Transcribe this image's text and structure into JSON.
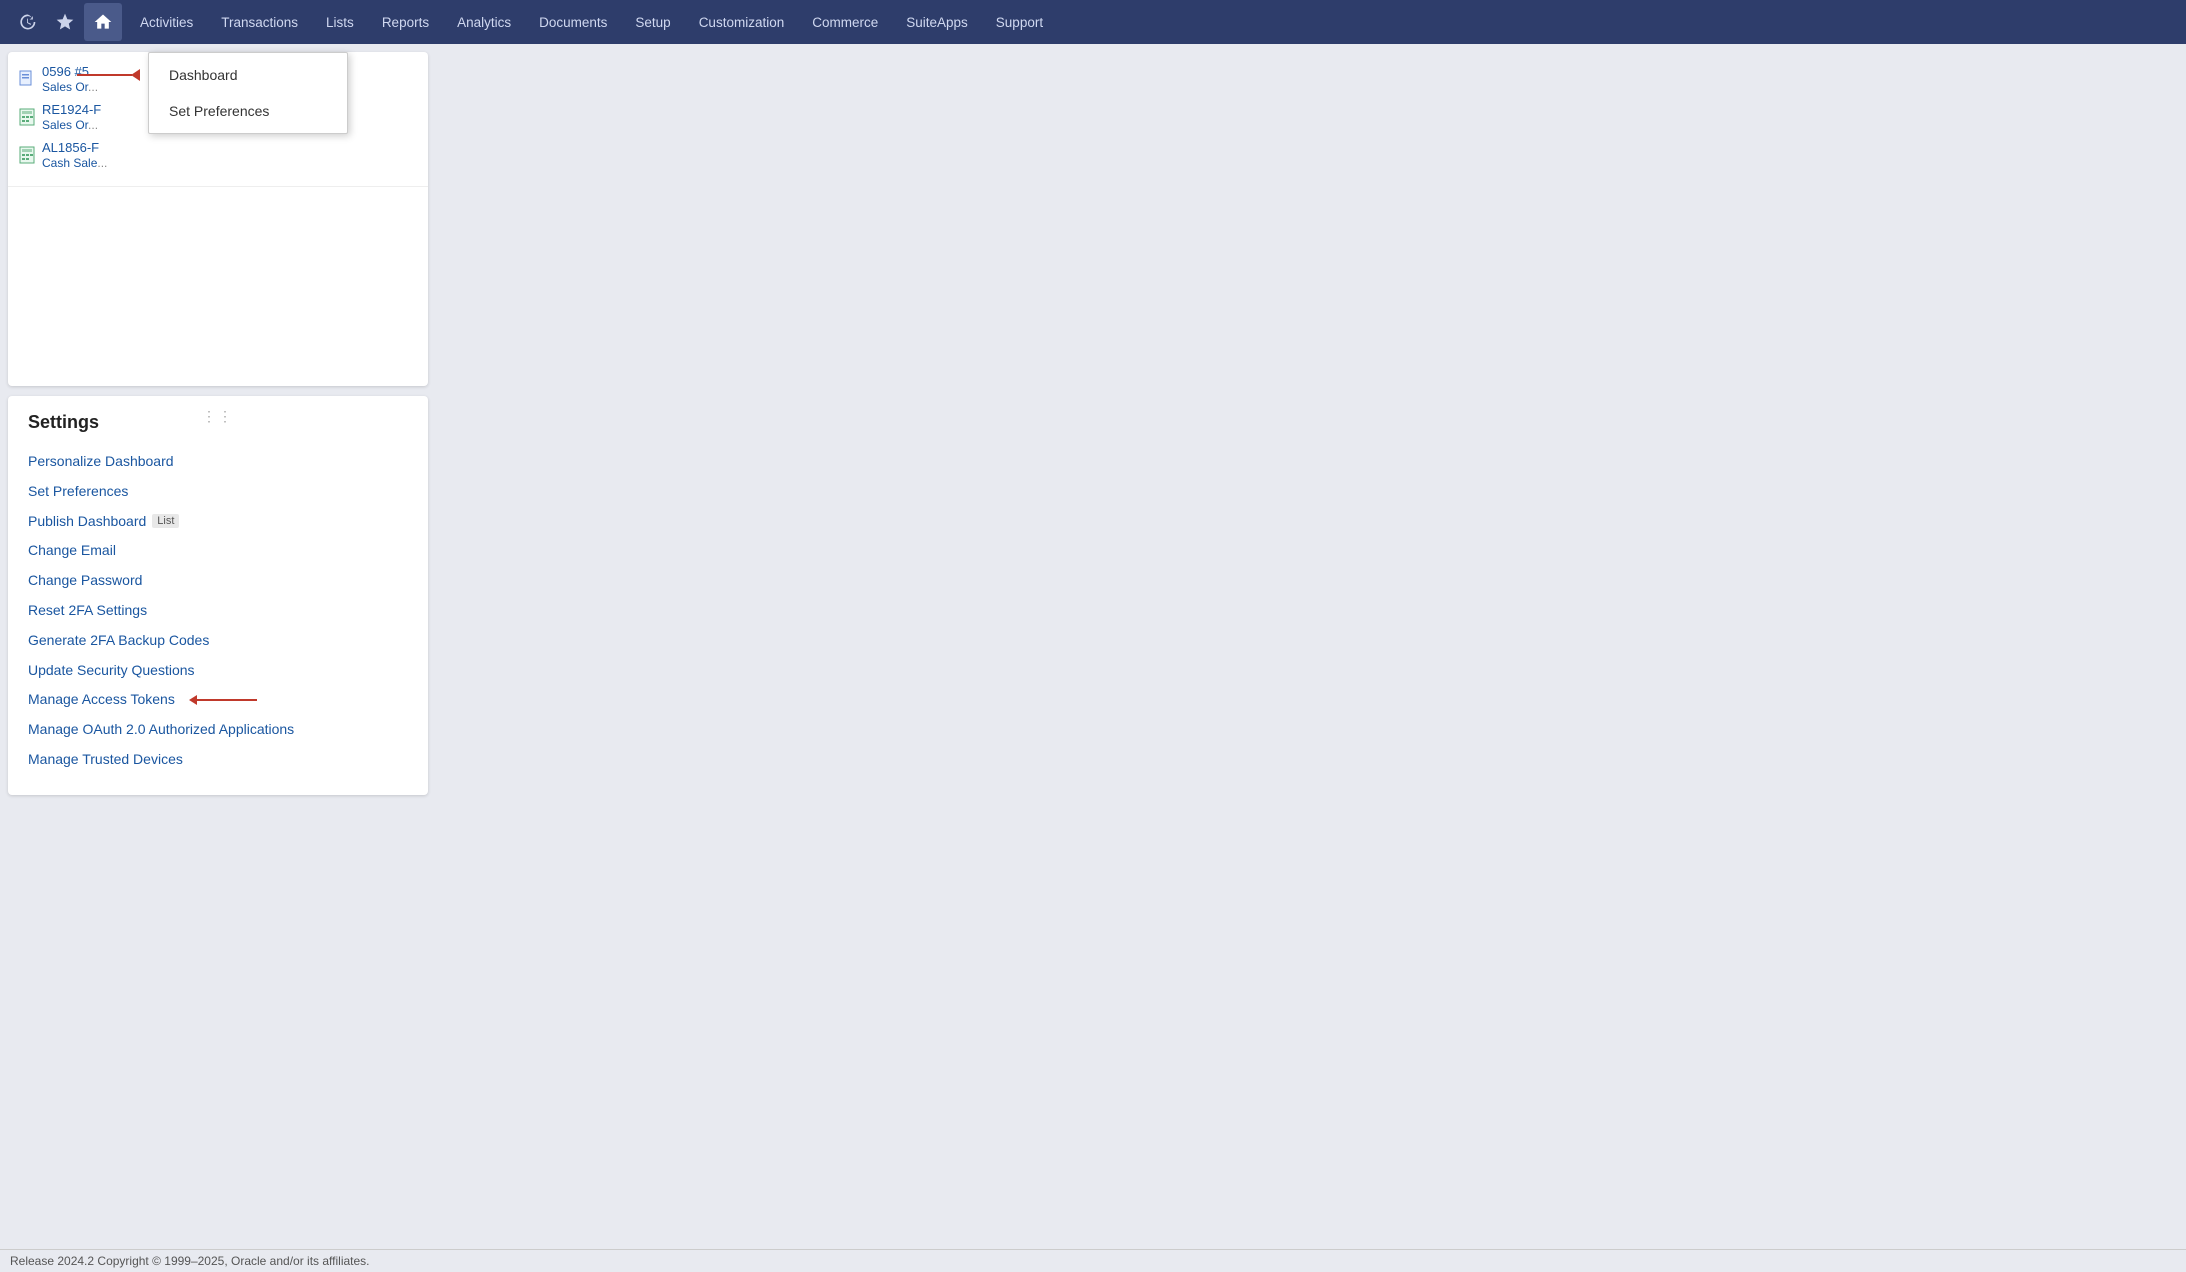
{
  "navbar": {
    "items": [
      {
        "label": "Activities",
        "id": "activities"
      },
      {
        "label": "Transactions",
        "id": "transactions"
      },
      {
        "label": "Lists",
        "id": "lists"
      },
      {
        "label": "Reports",
        "id": "reports"
      },
      {
        "label": "Analytics",
        "id": "analytics"
      },
      {
        "label": "Documents",
        "id": "documents"
      },
      {
        "label": "Setup",
        "id": "setup"
      },
      {
        "label": "Customization",
        "id": "customization"
      },
      {
        "label": "Commerce",
        "id": "commerce"
      },
      {
        "label": "SuiteApps",
        "id": "suiteapps"
      },
      {
        "label": "Support",
        "id": "support"
      }
    ]
  },
  "dropdown": {
    "items": [
      {
        "label": "Dashboard",
        "id": "dashboard"
      },
      {
        "label": "Set Preferences",
        "id": "set-preferences"
      }
    ]
  },
  "recent_items": [
    {
      "id": "item1",
      "code": "0596 #5",
      "name": "Sales Or...",
      "icon": "doc"
    },
    {
      "id": "item2",
      "code": "RE1924-F",
      "name": "Sales Or...",
      "icon": "calc"
    },
    {
      "id": "item3",
      "code": "AL1856-F",
      "name": "Cash Sale...",
      "icon": "calc"
    }
  ],
  "settings": {
    "title": "Settings",
    "links": [
      {
        "label": "Personalize Dashboard",
        "id": "personalize-dashboard",
        "badge": null
      },
      {
        "label": "Set Preferences",
        "id": "set-preferences",
        "badge": null
      },
      {
        "label": "Publish Dashboard",
        "id": "publish-dashboard",
        "badge": "List"
      },
      {
        "label": "Change Email",
        "id": "change-email",
        "badge": null
      },
      {
        "label": "Change Password",
        "id": "change-password",
        "badge": null
      },
      {
        "label": "Reset 2FA Settings",
        "id": "reset-2fa",
        "badge": null
      },
      {
        "label": "Generate 2FA Backup Codes",
        "id": "generate-2fa-backup",
        "badge": null
      },
      {
        "label": "Update Security Questions",
        "id": "update-security",
        "badge": null
      },
      {
        "label": "Manage Access Tokens",
        "id": "manage-access-tokens",
        "badge": null,
        "has_arrow": true
      },
      {
        "label": "Manage OAuth 2.0 Authorized Applications",
        "id": "manage-oauth",
        "badge": null
      },
      {
        "label": "Manage Trusted Devices",
        "id": "manage-trusted-devices",
        "badge": null
      }
    ]
  },
  "footer": {
    "text": "Release 2024.2  Copyright © 1999–2025, Oracle and/or its affiliates."
  }
}
